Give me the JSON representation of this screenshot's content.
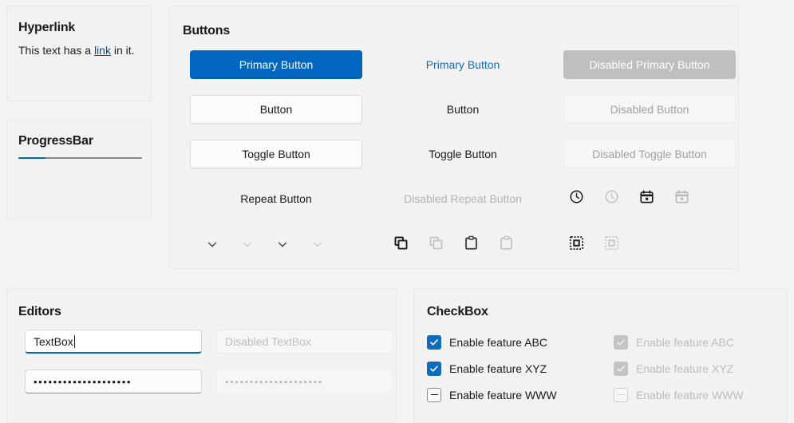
{
  "hyperlink": {
    "title": "Hyperlink",
    "text_before": "This text has a ",
    "link_label": "link",
    "text_after": " in it."
  },
  "progress": {
    "title": "ProgressBar",
    "value_percent": 22,
    "fill_color": "#0067c0",
    "track_color": "#868686"
  },
  "buttons": {
    "title": "Buttons",
    "rows": [
      {
        "filled": "Primary Button",
        "text": "Primary Button",
        "disabled": "Disabled Primary Button"
      },
      {
        "filled": "Button",
        "text": "Button",
        "disabled": "Disabled Button"
      },
      {
        "filled": "Toggle Button",
        "text": "Toggle Button",
        "disabled": "Disabled Toggle Button"
      },
      {
        "filled": "Repeat Button",
        "text": "Disabled Repeat Button",
        "disabled": ""
      }
    ],
    "icon_row_a": [
      {
        "name": "clock-icon",
        "state": "enabled"
      },
      {
        "name": "clock-icon",
        "state": "disabled"
      },
      {
        "name": "calendar-icon",
        "state": "enabled"
      },
      {
        "name": "calendar-icon",
        "state": "disabled"
      }
    ],
    "icon_row_b": [
      {
        "name": "chevron-down-icon",
        "state": "enabled"
      },
      {
        "name": "chevron-down-icon",
        "state": "disabled"
      },
      {
        "name": "chevron-down-icon",
        "state": "enabled"
      },
      {
        "name": "chevron-down-icon",
        "state": "disabled"
      },
      {
        "name": "copy-icon",
        "state": "enabled"
      },
      {
        "name": "copy-icon",
        "state": "disabled"
      },
      {
        "name": "paste-icon",
        "state": "enabled"
      },
      {
        "name": "paste-icon",
        "state": "disabled"
      },
      {
        "name": "select-all-icon",
        "state": "enabled"
      },
      {
        "name": "select-all-icon",
        "state": "disabled"
      }
    ],
    "primary_color": "#0066bf",
    "primary_disabled_color": "#bfbfbf",
    "link_text_color": "#0f6cbd"
  },
  "editors": {
    "title": "Editors",
    "textbox_value": "TextBox",
    "textbox_disabled_placeholder": "Disabled TextBox",
    "password_value": "••••••••••••••••••••",
    "password_disabled_value": "••••••••••••••••••••",
    "focus_accent": "#0067c0"
  },
  "checkbox": {
    "title": "CheckBox",
    "items": [
      {
        "label": "Enable feature ABC",
        "state": "checked",
        "enabled": true
      },
      {
        "label": "Enable feature XYZ",
        "state": "checked",
        "enabled": true
      },
      {
        "label": "Enable feature WWW",
        "state": "indeterminate",
        "enabled": true
      }
    ],
    "disabled_items": [
      {
        "label": "Enable feature ABC",
        "state": "checked",
        "enabled": false
      },
      {
        "label": "Enable feature XYZ",
        "state": "checked",
        "enabled": false
      },
      {
        "label": "Enable feature WWW",
        "state": "indeterminate",
        "enabled": false
      }
    ],
    "accent_color": "#0f6cbd"
  }
}
